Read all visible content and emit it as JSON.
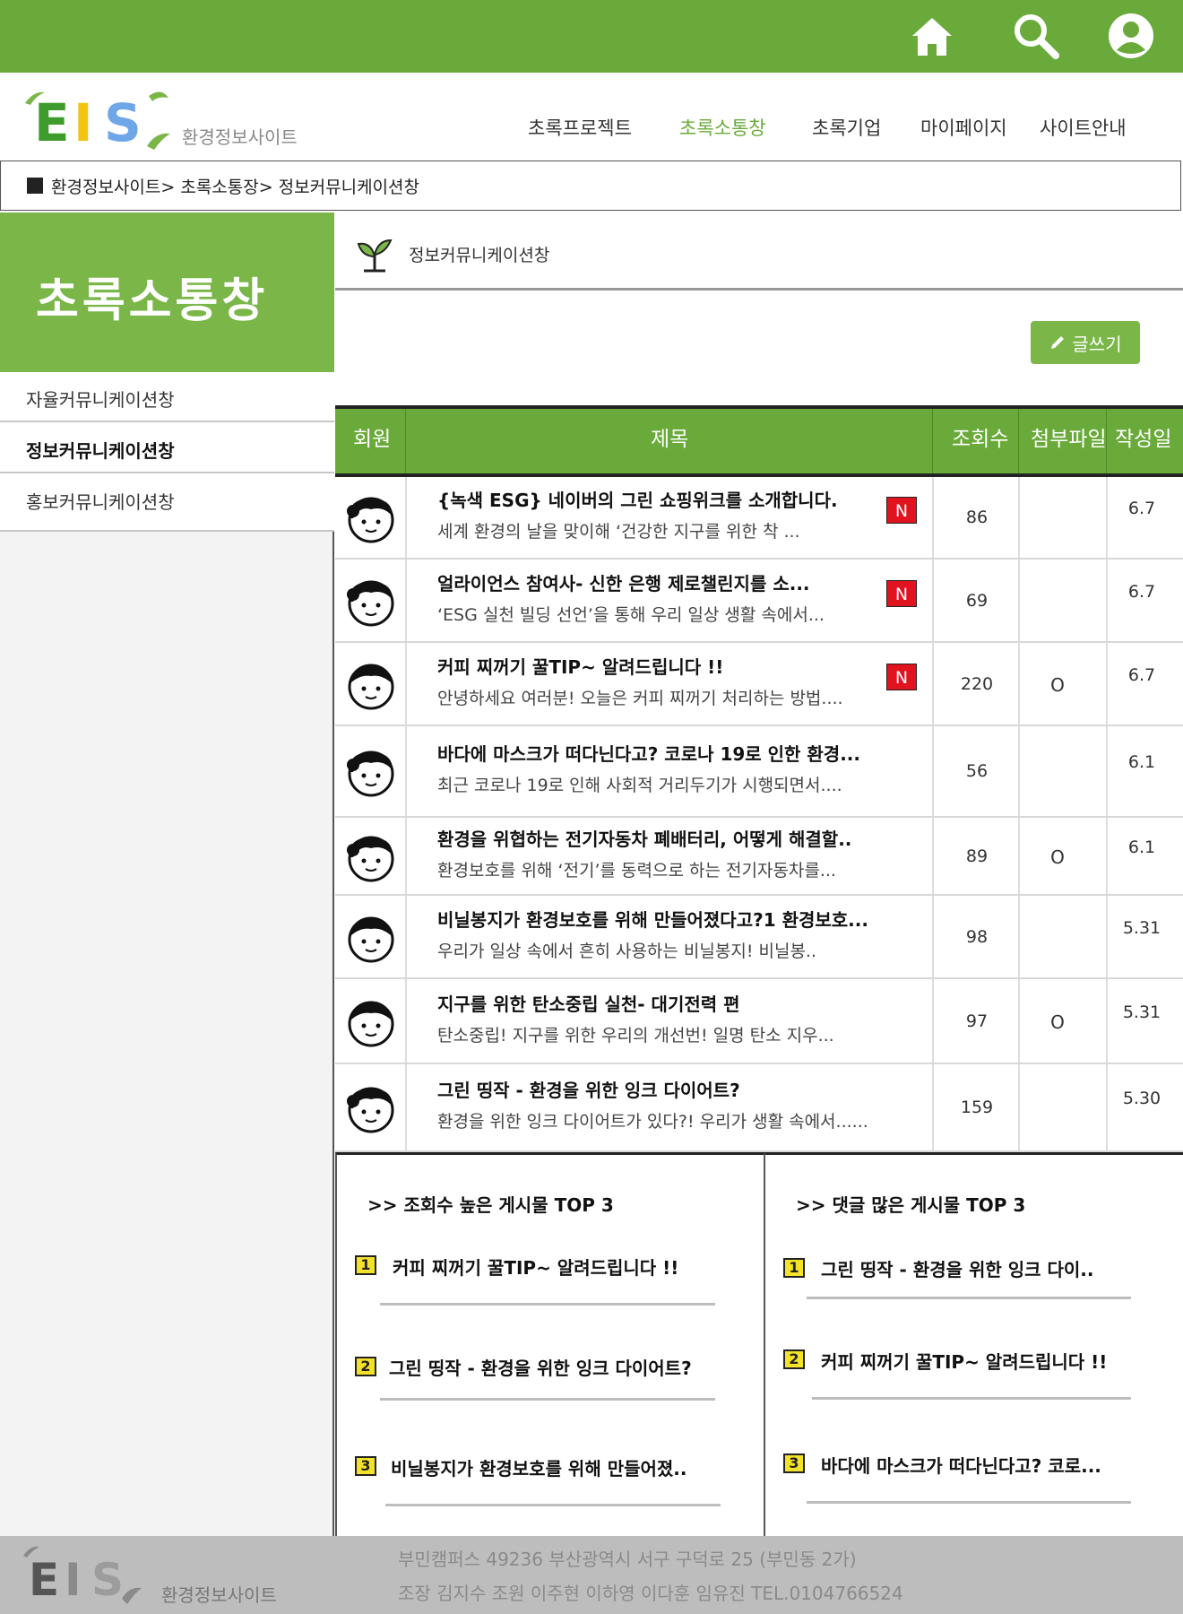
{
  "topbar": {
    "icons": [
      "home-icon",
      "search-icon",
      "user-icon"
    ]
  },
  "header": {
    "logo_text": "EIS",
    "logo_sub": "환경정보사이트",
    "nav": [
      "초록프로젝트",
      "초록소통창",
      "초록기업",
      "마이페이지",
      "사이트안내"
    ]
  },
  "breadcrumb": "환경정보사이트> 초록소통장> 정보커뮤니케이션창",
  "sidebar": {
    "title": "초록소통창",
    "items": [
      "자율커뮤니케이션창",
      "정보커뮤니케이션창",
      "홍보커뮤니케이션창"
    ]
  },
  "content": {
    "title": "정보커뮤니케이션창",
    "write_button": "글쓰기"
  },
  "table": {
    "headers": [
      "회원",
      "제목",
      "조회수",
      "첨부파일",
      "작성일"
    ],
    "rows": [
      {
        "title": "{녹색 ESG} 네이버의 그린 쇼핑위크를 소개합니다.",
        "summary": "세계 환경의 날을 맞이해 ‘건강한 지구를 위한 착 ...",
        "badge": "N",
        "views": "86",
        "attach": "",
        "date": "6.7"
      },
      {
        "title": "얼라이언스 참여사- 신한 은행 제로챌린지를 소...",
        "summary": "‘ESG 실천 빌딩 선언’을 통해 우리 일상 생활 속에서...",
        "badge": "N",
        "views": "69",
        "attach": "",
        "date": "6.7"
      },
      {
        "title": "커피 찌꺼기 꿀TIP~ 알려드립니다 !!",
        "summary": "안녕하세요 여러분! 오늘은 커피 찌꺼기 처리하는 방법....",
        "badge": "N",
        "views": "220",
        "attach": "O",
        "date": "6.7"
      },
      {
        "title": "바다에 마스크가 떠다닌다고? 코로나 19로 인한 환경...",
        "summary": "최근 코로나 19로 인해 사회적 거리두기가 시행되면서....",
        "badge": "",
        "views": "56",
        "attach": "",
        "date": "6.1"
      },
      {
        "title": "환경을 위협하는 전기자동차 폐배터리, 어떻게 해결할..",
        "summary": "환경보호를 위해 ‘전기’를 동력으로 하는 전기자동차를...",
        "badge": "",
        "views": "89",
        "attach": "O",
        "date": "6.1"
      },
      {
        "title": "비닐봉지가 환경보호를 위해 만들어졌다고?1 환경보호...",
        "summary": "우리가 일상 속에서 흔히 사용하는 비닐봉지! 비닐봉..",
        "badge": "",
        "views": "98",
        "attach": "",
        "date": "5.31"
      },
      {
        "title": "지구를 위한 탄소중립 실천- 대기전력 편",
        "summary": "탄소중립! 지구를 위한 우리의 개선번! 일명 탄소 지우...",
        "badge": "",
        "views": "97",
        "attach": "O",
        "date": "5.31"
      },
      {
        "title": "그린 띵작 - 환경을 위한 잉크 다이어트?",
        "summary": "환경을 위한 잉크 다이어트가 있다?! 우리가 생활 속에서......",
        "badge": "",
        "views": "159",
        "attach": "",
        "date": "5.30"
      }
    ]
  },
  "top_views": {
    "title": ">> 조회수 높은 게시물 TOP 3",
    "items": [
      {
        "rank": "1",
        "text": "커피 찌꺼기 꿀TIP~ 알려드립니다 !!"
      },
      {
        "rank": "2",
        "text": "그린 띵작 - 환경을 위한 잉크 다이어트?"
      },
      {
        "rank": "3",
        "text": "비닐봉지가 환경보호를 위해 만들어졌.."
      }
    ]
  },
  "top_comments": {
    "title": ">> 댓글 많은 게시물 TOP 3",
    "items": [
      {
        "rank": "1",
        "text": "그린 띵작 - 환경을 위한 잉크 다이.."
      },
      {
        "rank": "2",
        "text": "커피 찌꺼기 꿀TIP~ 알려드립니다 !!"
      },
      {
        "rank": "3",
        "text": "바다에 마스크가 떠다닌다고? 코로..."
      }
    ]
  },
  "footer": {
    "logo_text": "EIS",
    "logo_sub": "환경정보사이트",
    "address": "부민캠퍼스 49236 부산광역시 서구 구덕로 25 (부민동 2가)",
    "members": "조장 김지수 조원 이주현 이하영 이다훈 임유진  TEL.0104766524"
  },
  "colors": {
    "brand_green": "#6aaa3a",
    "sidebar_green": "#7ab648",
    "new_badge": "#e0141e",
    "rank_yellow": "#f4e22a",
    "footer_gray": "#bdbdbd"
  }
}
